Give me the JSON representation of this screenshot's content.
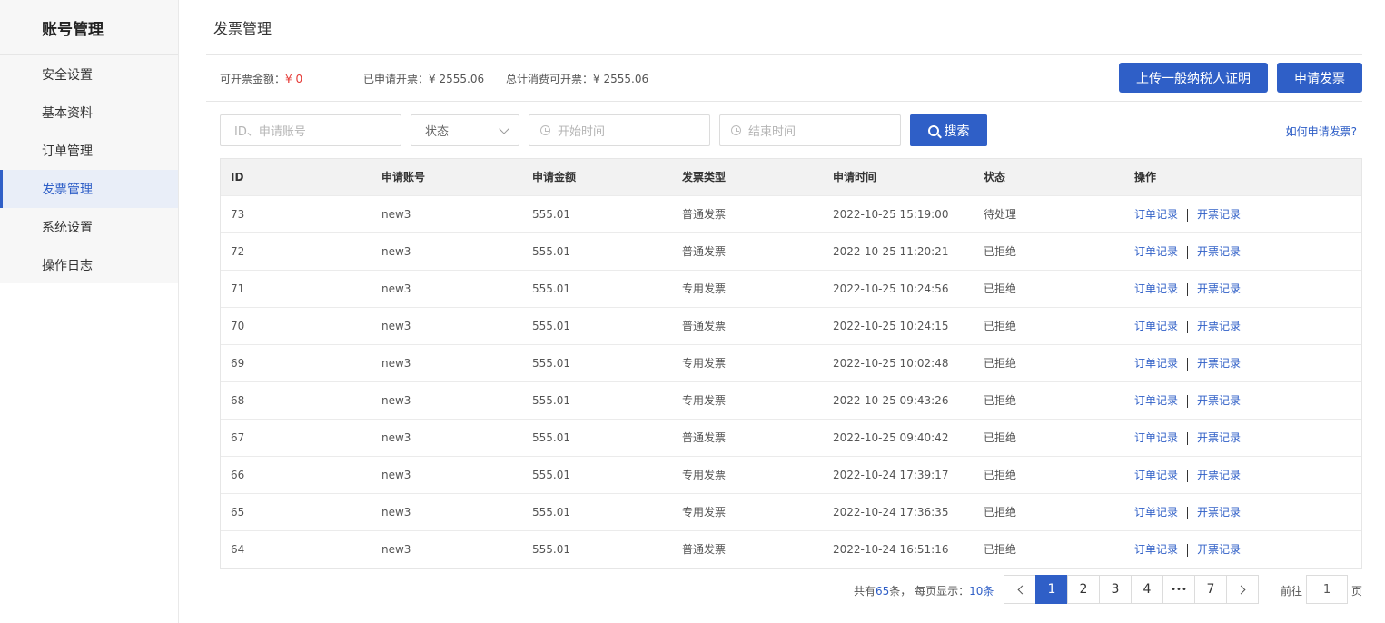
{
  "sidebar": {
    "title": "账号管理",
    "items": [
      {
        "label": "安全设置",
        "active": false
      },
      {
        "label": "基本资料",
        "active": false
      },
      {
        "label": "订单管理",
        "active": false
      },
      {
        "label": "发票管理",
        "active": true
      },
      {
        "label": "系统设置",
        "active": false
      },
      {
        "label": "操作日志",
        "active": false
      }
    ]
  },
  "header": {
    "title": "发票管理"
  },
  "summary": {
    "available_label": "可开票金额：",
    "available_value": "¥ 0",
    "applied_label": "已申请开票：",
    "applied_value": "¥ 2555.06",
    "total_label": "总计消费可开票：",
    "total_value": "¥ 2555.06"
  },
  "actions": {
    "upload_label": "上传一般纳税人证明",
    "apply_label": "申请发票"
  },
  "filters": {
    "id_placeholder": "ID、申请账号",
    "status_value": "状态",
    "start_placeholder": "开始时间",
    "end_placeholder": "结束时间",
    "search_label": "搜索",
    "help_link": "如何申请发票?"
  },
  "table": {
    "columns": [
      "ID",
      "申请账号",
      "申请金额",
      "发票类型",
      "申请时间",
      "状态",
      "操作"
    ],
    "action_order": "订单记录",
    "action_invoice": "开票记录",
    "rows": [
      {
        "id": "73",
        "account": "new3",
        "amount": "555.01",
        "type": "普通发票",
        "time": "2022-10-25 15:19:00",
        "status": "待处理"
      },
      {
        "id": "72",
        "account": "new3",
        "amount": "555.01",
        "type": "普通发票",
        "time": "2022-10-25 11:20:21",
        "status": "已拒绝"
      },
      {
        "id": "71",
        "account": "new3",
        "amount": "555.01",
        "type": "专用发票",
        "time": "2022-10-25 10:24:56",
        "status": "已拒绝"
      },
      {
        "id": "70",
        "account": "new3",
        "amount": "555.01",
        "type": "普通发票",
        "time": "2022-10-25 10:24:15",
        "status": "已拒绝"
      },
      {
        "id": "69",
        "account": "new3",
        "amount": "555.01",
        "type": "专用发票",
        "time": "2022-10-25 10:02:48",
        "status": "已拒绝"
      },
      {
        "id": "68",
        "account": "new3",
        "amount": "555.01",
        "type": "专用发票",
        "time": "2022-10-25 09:43:26",
        "status": "已拒绝"
      },
      {
        "id": "67",
        "account": "new3",
        "amount": "555.01",
        "type": "普通发票",
        "time": "2022-10-25 09:40:42",
        "status": "已拒绝"
      },
      {
        "id": "66",
        "account": "new3",
        "amount": "555.01",
        "type": "专用发票",
        "time": "2022-10-24 17:39:17",
        "status": "已拒绝"
      },
      {
        "id": "65",
        "account": "new3",
        "amount": "555.01",
        "type": "专用发票",
        "time": "2022-10-24 17:36:35",
        "status": "已拒绝"
      },
      {
        "id": "64",
        "account": "new3",
        "amount": "555.01",
        "type": "普通发票",
        "time": "2022-10-24 16:51:16",
        "status": "已拒绝"
      }
    ]
  },
  "pagination": {
    "total_prefix": "共有",
    "total_count": "65",
    "total_suffix": "条，",
    "per_page_prefix": "每页显示：",
    "per_page_value": "10条",
    "pages": [
      "1",
      "2",
      "3",
      "4",
      "•••",
      "7"
    ],
    "current_page": "1",
    "goto_label": "前往",
    "goto_value": "1",
    "page_unit": "页"
  },
  "colors": {
    "accent": "#2f5fc7",
    "danger": "#e53935"
  },
  "icons": [
    "chevron-down-icon",
    "clock-icon",
    "search-icon",
    "chevron-left-icon",
    "chevron-right-icon"
  ]
}
